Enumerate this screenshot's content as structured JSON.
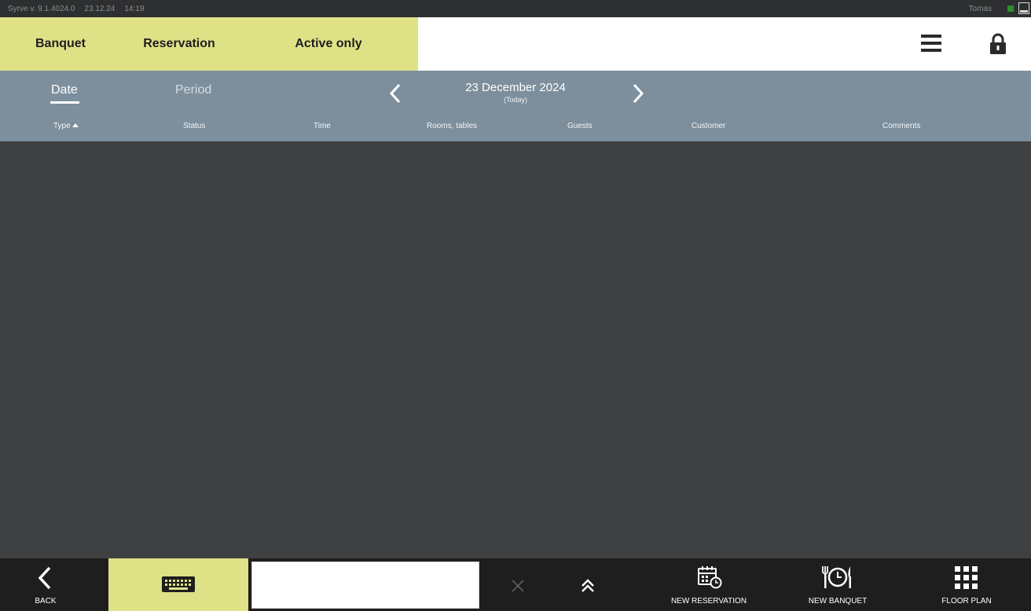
{
  "titlebar": {
    "app_version": "Syrve  v. 9.1.4024.0",
    "date": "23.12.24",
    "time": "14:19",
    "user": "Tomas"
  },
  "tabs": {
    "banquet": "Banquet",
    "reservation": "Reservation",
    "active_only": "Active only"
  },
  "filter": {
    "date_mode": "Date",
    "period_mode": "Period",
    "current_date": "23 December 2024",
    "today_note": "(Today)"
  },
  "columns": {
    "type": "Type",
    "status": "Status",
    "time": "Time",
    "rooms_tables": "Rooms, tables",
    "guests": "Guests",
    "customer": "Customer",
    "comments": "Comments"
  },
  "search": {
    "value": "",
    "placeholder": ""
  },
  "bottom": {
    "back": "BACK",
    "new_reservation": "NEW RESERVATION",
    "new_banquet": "NEW BANQUET",
    "floor_plan": "FLOOR PLAN"
  },
  "colors": {
    "accent": "#dfe187",
    "header_grey": "#7d8f9d",
    "content_bg": "#3f4041",
    "toolbar_bg": "#1e1e1e"
  }
}
